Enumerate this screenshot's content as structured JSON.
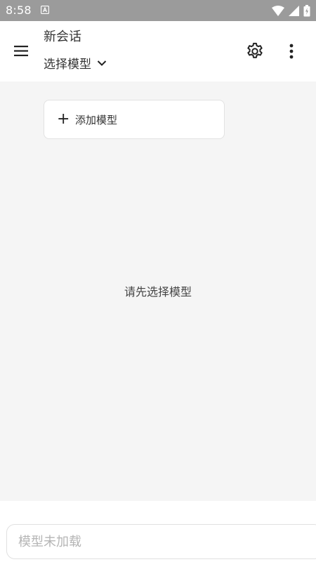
{
  "status_bar": {
    "time": "8:58",
    "icons": [
      "notification-a-icon",
      "wifi-icon",
      "signal-icon",
      "battery-charging-icon"
    ]
  },
  "app_bar": {
    "title": "新会话",
    "model_select_label": "选择模型",
    "icons": [
      "menu-icon",
      "chevron-down-icon",
      "gear-icon",
      "more-vert-icon"
    ]
  },
  "main": {
    "add_model_label": "添加模型",
    "empty_hint": "请先选择模型"
  },
  "composer": {
    "placeholder": "模型未加载"
  },
  "colors": {
    "status_bar_bg": "#9b9b9b",
    "app_bar_bg": "#ffffff",
    "content_bg": "#f5f5f5"
  }
}
